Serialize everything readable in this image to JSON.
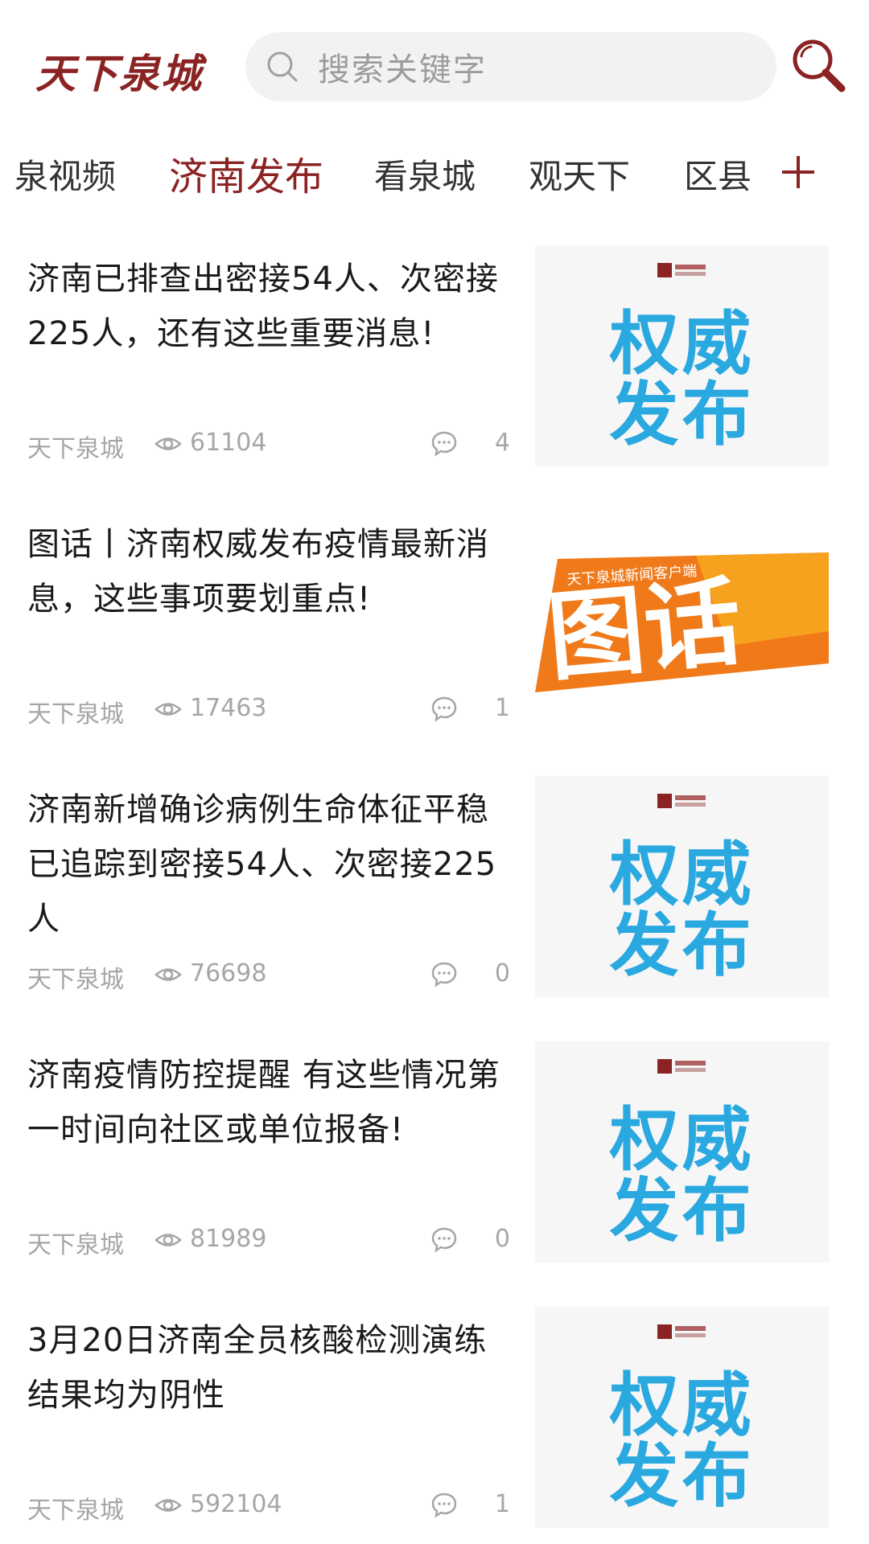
{
  "header": {
    "logo_text": "天下泉城",
    "search_placeholder": "搜索关键字"
  },
  "tabs": [
    {
      "label": "泉视频"
    },
    {
      "label": "济南发布"
    },
    {
      "label": "看泉城"
    },
    {
      "label": "观天下"
    },
    {
      "label": "区县"
    }
  ],
  "colors": {
    "brand": "#8b2323",
    "thumb_text": "#2aa8e0",
    "tuhua_orange": "#f07a1a"
  },
  "articles": [
    {
      "title": "济南已排查出密接54人、次密接225人，还有这些重要消息!",
      "source": "天下泉城",
      "views": "61104",
      "comments": "4",
      "thumb": {
        "line1": "权威",
        "line2": "发布"
      }
    },
    {
      "title": "图话丨济南权威发布疫情最新消息，这些事项要划重点!",
      "source": "天下泉城",
      "views": "17463",
      "comments": "1",
      "thumb": {
        "tuhua_caption": "天下泉城新闻客户端",
        "tuhua_text": "图话"
      }
    },
    {
      "title": "济南新增确诊病例生命体征平稳  已追踪到密接54人、次密接225人",
      "source": "天下泉城",
      "views": "76698",
      "comments": "0",
      "thumb": {
        "line1": "权威",
        "line2": "发布"
      }
    },
    {
      "title": "济南疫情防控提醒  有这些情况第一时间向社区或单位报备!",
      "source": "天下泉城",
      "views": "81989",
      "comments": "0",
      "thumb": {
        "line1": "权威",
        "line2": "发布"
      }
    },
    {
      "title": "3月20日济南全员核酸检测演练结果均为阴性",
      "source": "天下泉城",
      "views": "592104",
      "comments": "1",
      "thumb": {
        "line1": "权威",
        "line2": "发布"
      }
    }
  ]
}
